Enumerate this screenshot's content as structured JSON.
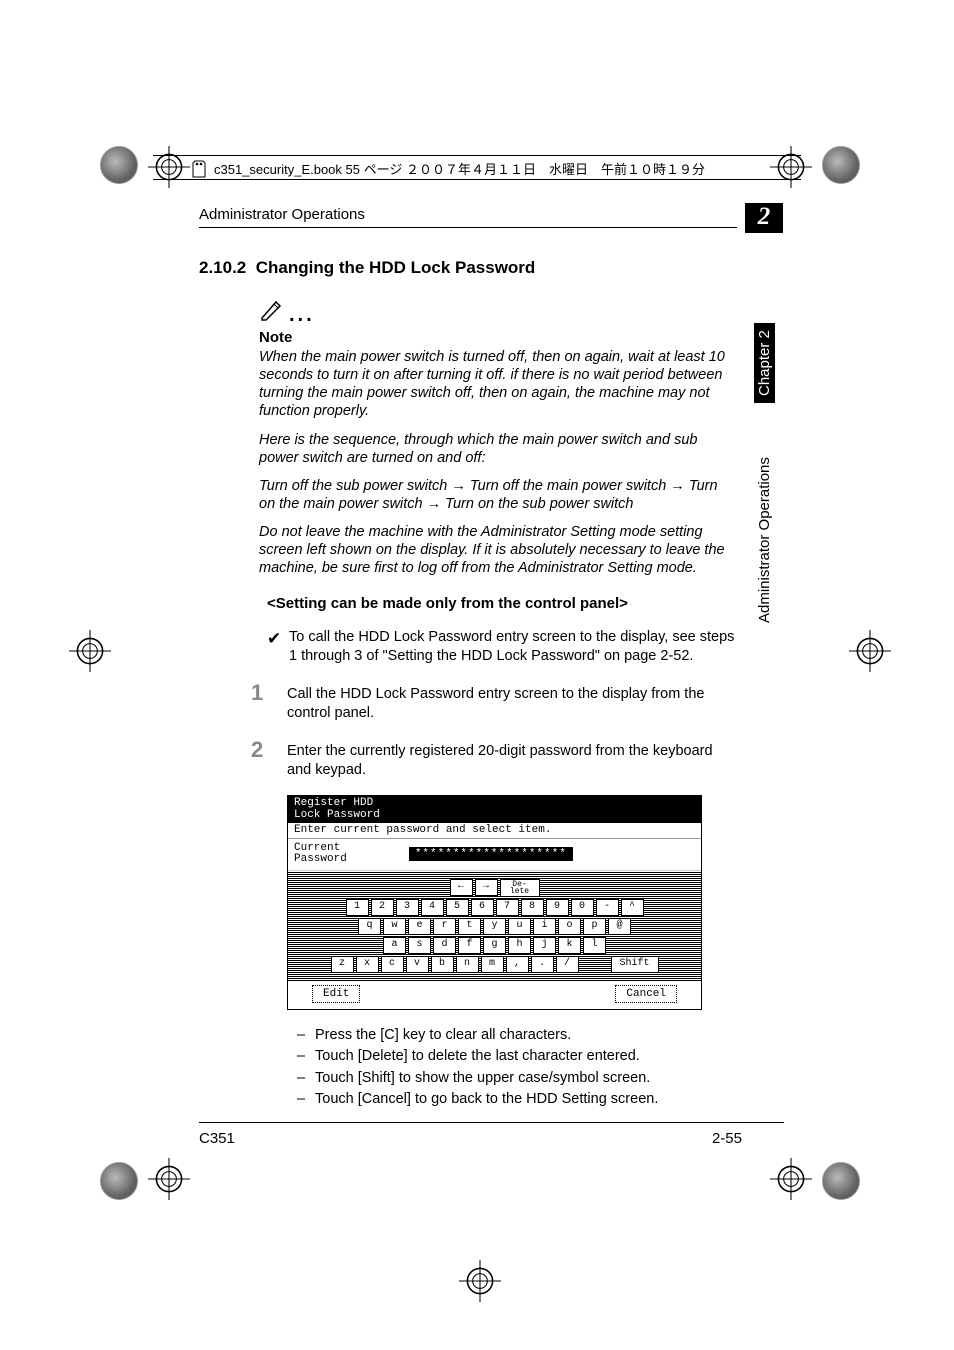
{
  "meta": {
    "line": "c351_security_E.book  55 ページ  ２００７年４月１１日　水曜日　午前１０時１９分"
  },
  "header": {
    "running": "Administrator Operations",
    "chapter_badge": "2"
  },
  "section": {
    "number": "2.10.2",
    "title": "Changing the HDD Lock Password"
  },
  "note": {
    "label": "Note",
    "p1": "When the main power switch is turned off, then on again, wait at least 10 seconds to turn it on after turning it off. if there is no wait period between turning the main power switch off, then on again, the machine may not function properly.",
    "p2": "Here is the sequence, through which the main power switch and sub power switch are turned on and off:",
    "p3a": "Turn off the sub power switch ",
    "p3b": " Turn off the main power switch ",
    "p3c": " Turn on the main power switch ",
    "p3d": " Turn on the sub power switch",
    "p4": "Do not leave the machine with the Administrator Setting mode setting screen left shown on the display. If it is absolutely necessary to leave the machine, be sure first to log off from the Administrator Setting mode."
  },
  "subhead": "<Setting can be made only from the control panel>",
  "prereq": "To call the HDD Lock Password entry screen to the display, see steps 1 through 3 of \"Setting the HDD Lock Password\" on page 2-52.",
  "steps": {
    "s1": "Call the HDD Lock Password entry screen to the display from the control panel.",
    "s2": "Enter the currently registered 20-digit password from the keyboard and keypad."
  },
  "figure": {
    "title": "Register HDD\nLock Password",
    "instr": "Enter current password and select item.",
    "cur_label": "Current\nPassword",
    "cur_value": "********************",
    "rows": {
      "r0": [
        "←",
        "→",
        "De-\nlete"
      ],
      "r1": [
        "1",
        "2",
        "3",
        "4",
        "5",
        "6",
        "7",
        "8",
        "9",
        "0",
        "-",
        "^"
      ],
      "r2": [
        "q",
        "w",
        "e",
        "r",
        "t",
        "y",
        "u",
        "i",
        "o",
        "p",
        "@"
      ],
      "r3": [
        "a",
        "s",
        "d",
        "f",
        "g",
        "h",
        "j",
        "k",
        "l"
      ],
      "r4": [
        "z",
        "x",
        "c",
        "v",
        "b",
        "n",
        "m",
        ",",
        ".",
        "/"
      ]
    },
    "shift": "Shift",
    "edit": "Edit",
    "cancel": "Cancel"
  },
  "hints": {
    "h1": "Press the [C] key to clear all characters.",
    "h2": "Touch [Delete] to delete the last character entered.",
    "h3": "Touch [Shift] to show the upper case/symbol screen.",
    "h4": "Touch [Cancel] to go back to the HDD Setting screen."
  },
  "sidetab": {
    "chapter": "Chapter 2",
    "label": "Administrator Operations"
  },
  "footer": {
    "model": "C351",
    "page": "2-55"
  }
}
